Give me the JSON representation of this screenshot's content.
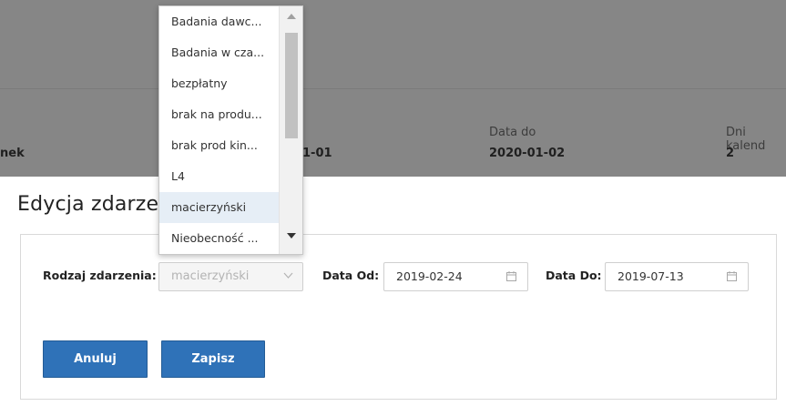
{
  "background": {
    "col1_value": "nek",
    "col2_value": "1-01",
    "col3_label": "Data do",
    "col3_value": "2020-01-02",
    "col4_label": "Dni kalend",
    "col4_value": "2"
  },
  "modal": {
    "title": "Edycja zdarze",
    "event_type_label": "Rodzaj zdarzenia:",
    "event_type_value": "macierzyński",
    "date_from_label": "Data Od:",
    "date_from_value": "2019-02-24",
    "date_to_label": "Data Do:",
    "date_to_value": "2019-07-13",
    "cancel_label": "Anuluj",
    "save_label": "Zapisz"
  },
  "dropdown": {
    "options": [
      "Badania dawc...",
      "Badania w cza...",
      "bezpłatny",
      "brak na produ...",
      "brak prod kin...",
      "L4",
      "macierzyński",
      "Nieobecność ..."
    ],
    "selected": "macierzyński"
  },
  "icons": {
    "calendar": "calendar-icon",
    "chevron": "chevron-down-icon",
    "scroll_up": "scroll-up-arrow-icon",
    "scroll_down": "scroll-down-arrow-icon"
  },
  "colors": {
    "accent": "#2f72b8",
    "overlay": "#868686",
    "selected_option": "#e6eef6"
  }
}
